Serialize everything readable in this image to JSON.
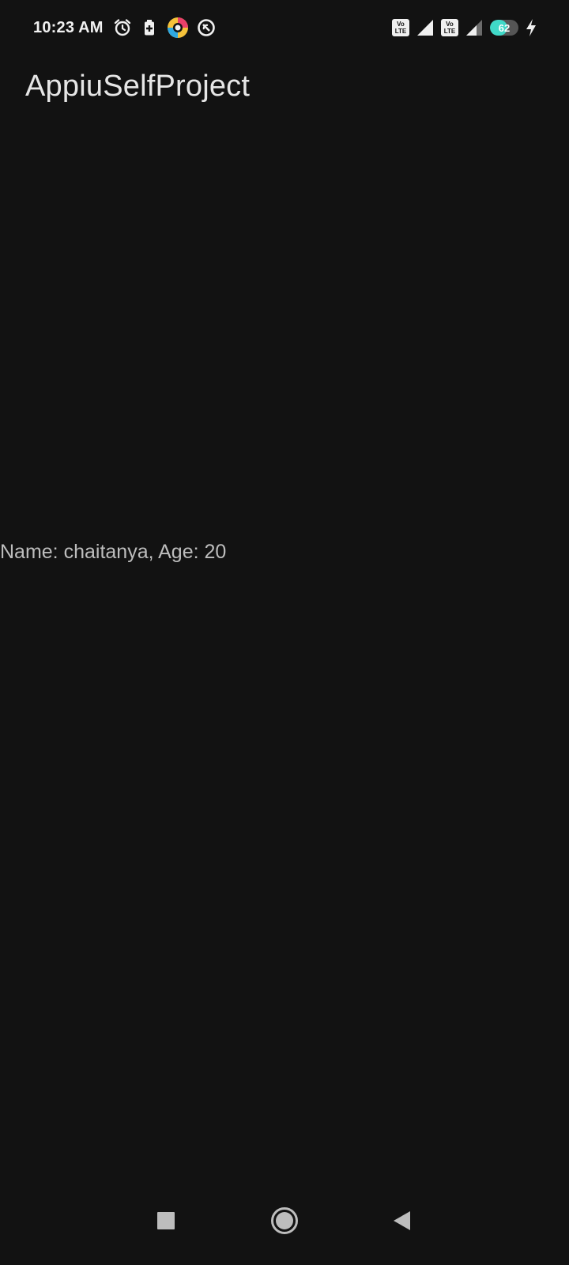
{
  "status_bar": {
    "time": "10:23 AM",
    "volte_label_top": "Vo",
    "volte_label_bottom": "LTE",
    "battery_level": 62,
    "battery_text": "62",
    "left_icons": [
      "alarm-icon",
      "battery-saver-icon",
      "app-notification-icon",
      "dnd-icon"
    ],
    "right_icons": [
      "volte-icon",
      "signal-icon",
      "volte-icon",
      "signal-icon",
      "battery-icon",
      "charging-icon"
    ],
    "battery_color": "#40d9c8"
  },
  "app_bar": {
    "title": "AppiuSelfProject"
  },
  "main": {
    "text": "Name: chaitanya, Age: 20"
  },
  "nav_bar": {
    "buttons": [
      "recents-icon",
      "home-icon",
      "back-icon"
    ]
  },
  "colors": {
    "background": "#121212",
    "title_text": "#e6e6e6",
    "body_text": "#bdbdbd"
  }
}
